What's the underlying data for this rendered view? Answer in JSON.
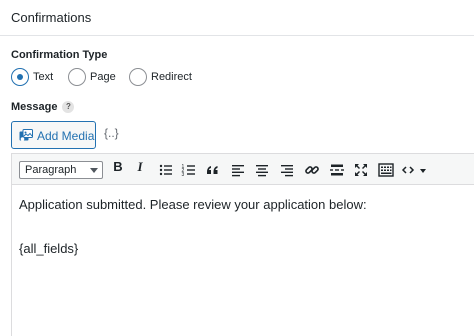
{
  "panel": {
    "title": "Confirmations"
  },
  "confirmation_type": {
    "label": "Confirmation Type",
    "options": [
      {
        "label": "Text",
        "selected": true
      },
      {
        "label": "Page",
        "selected": false
      },
      {
        "label": "Redirect",
        "selected": false
      }
    ]
  },
  "message": {
    "label": "Message",
    "help": "?"
  },
  "media": {
    "add_media_label": "Add Media",
    "merge_tag_label": "{..}"
  },
  "toolbar": {
    "format_value": "Paragraph",
    "bold": "B",
    "italic": "I",
    "icons": [
      "bold-icon",
      "italic-icon",
      "bulleted-list-icon",
      "numbered-list-icon",
      "blockquote-icon",
      "align-left-icon",
      "align-center-icon",
      "align-right-icon",
      "link-icon",
      "read-more-icon",
      "fullscreen-icon",
      "toolbar-toggle-icon",
      "code-icon",
      "dropdown-icon"
    ]
  },
  "editor": {
    "paragraphs": [
      "Application submitted. Please review your application below:",
      "{all_fields}"
    ]
  },
  "colors": {
    "accent": "#2271b1",
    "border": "#dcdcde",
    "toolbar_bg": "#f6f7f7"
  }
}
